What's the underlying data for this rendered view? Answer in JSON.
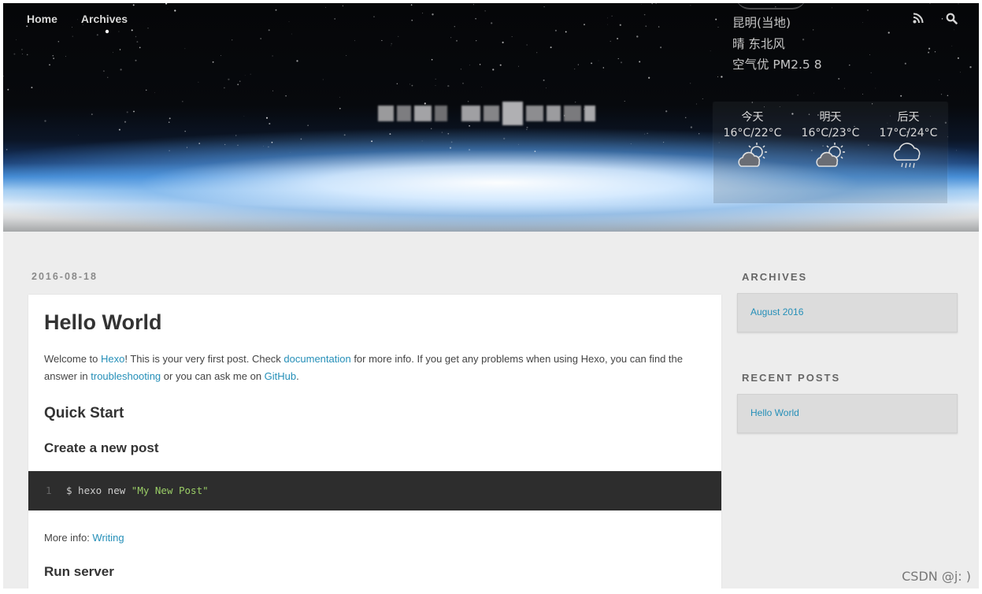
{
  "nav": {
    "home_label": "Home",
    "archives_label": "Archives"
  },
  "header_icons": [
    "rss-icon",
    "search-icon"
  ],
  "weather": {
    "location": "昆明(当地)",
    "condition": "晴 东北风",
    "air_quality": "空气优 PM2.5 8",
    "forecast": [
      {
        "day": "今天",
        "temp": "16°C/22°C",
        "icon": "partly-cloudy-icon"
      },
      {
        "day": "明天",
        "temp": "16°C/23°C",
        "icon": "partly-cloudy-icon"
      },
      {
        "day": "后天",
        "temp": "17°C/24°C",
        "icon": "rain-icon"
      }
    ]
  },
  "post": {
    "date": "2016-08-18",
    "title": "Hello World",
    "intro": {
      "t1": "Welcome to ",
      "link_hexo": "Hexo",
      "t2": "! This is your very first post. Check ",
      "link_docs": "documentation",
      "t3": " for more info. If you get any problems when using Hexo, you can find the answer in ",
      "link_troubleshooting": "troubleshooting",
      "t4": " or you can ask me on ",
      "link_github": "GitHub",
      "t5": "."
    },
    "h_quick_start": "Quick Start",
    "h_create_post": "Create a new post",
    "code": {
      "line_no": "1",
      "prefix": "$ hexo new ",
      "string": "\"My New Post\""
    },
    "more_info_label": "More info: ",
    "more_info_link": "Writing",
    "h_run_server": "Run server"
  },
  "sidebar": {
    "archives_title": "ARCHIVES",
    "archives_item": "August 2016",
    "recent_title": "RECENT POSTS",
    "recent_item": "Hello World"
  },
  "watermark": "CSDN @j: )",
  "colors": {
    "link": "#258fb8",
    "page_bg": "#ededed",
    "code_bg": "#2d2d2d",
    "code_string": "#99cc66"
  }
}
